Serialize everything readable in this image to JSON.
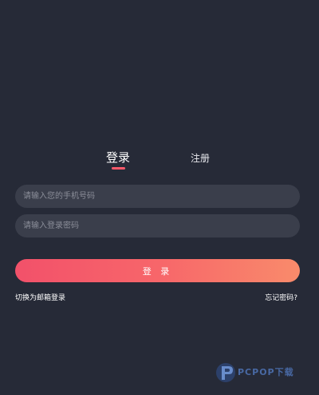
{
  "tabs": {
    "login_label": "登录",
    "register_label": "注册"
  },
  "form": {
    "phone_placeholder": "请输入您的手机号码",
    "phone_value": "",
    "password_placeholder": "请输入登录密码",
    "password_value": ""
  },
  "actions": {
    "login_button_label": "登 录",
    "switch_email_login": "切换为邮箱登录",
    "forgot_password": "忘记密码?"
  },
  "watermark": {
    "text": "PCPOP下载"
  },
  "colors": {
    "background": "#262a37",
    "field": "#3a3e4b",
    "accent": "#ff5a6b",
    "gradient_start": "#f2516a",
    "gradient_end": "#f98b6b"
  }
}
